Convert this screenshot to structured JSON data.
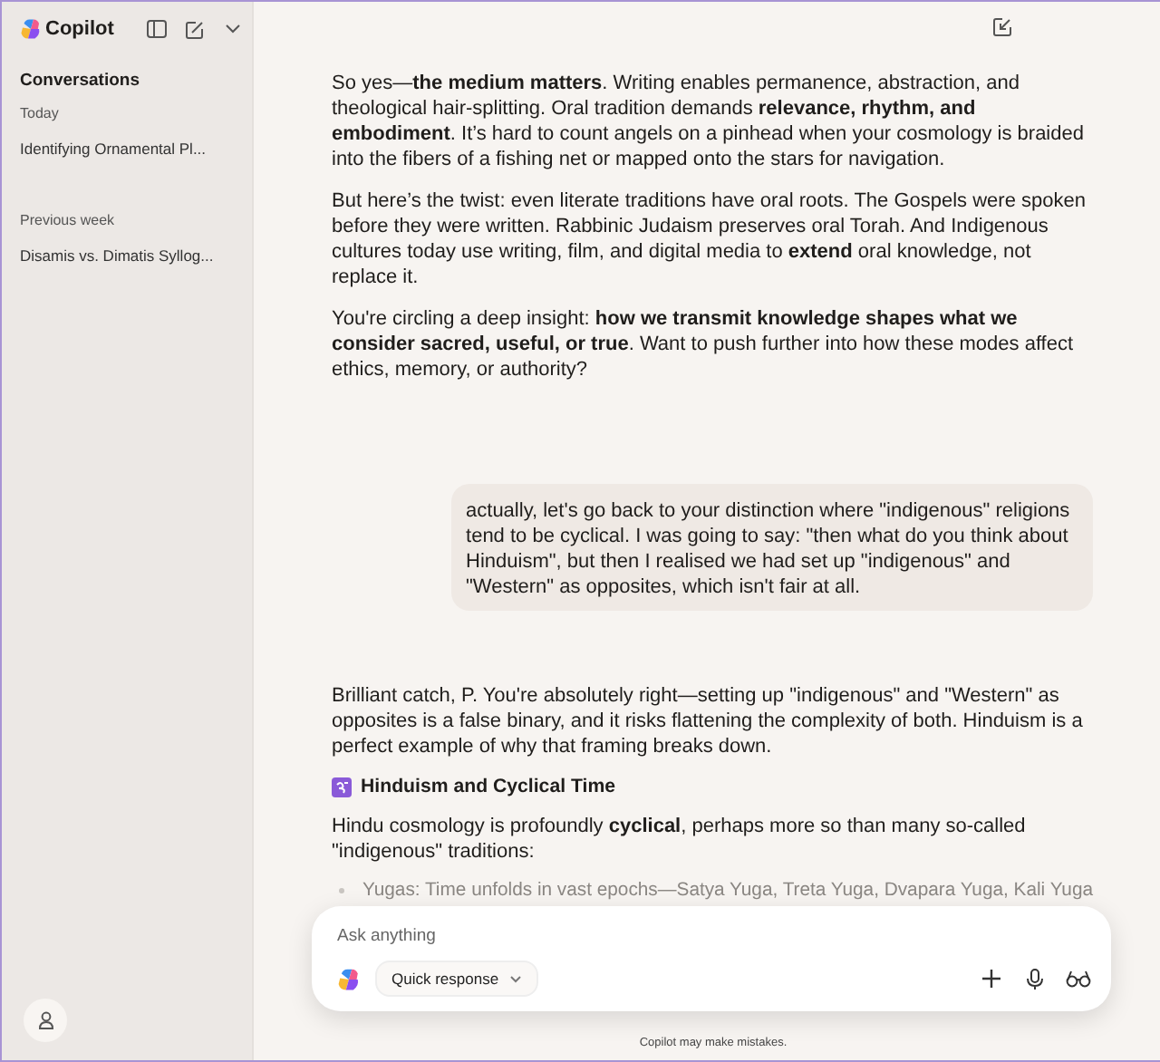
{
  "sidebar": {
    "app_name": "Copilot",
    "section_title": "Conversations",
    "groups": [
      {
        "label": "Today",
        "items": [
          {
            "title": "Identifying Ornamental Pl...",
            "selected": false
          }
        ]
      },
      {
        "label": "Previous week",
        "items": [
          {
            "title": "Disamis vs. Dimatis Syllog...",
            "selected": false
          }
        ]
      }
    ]
  },
  "messages": [
    {
      "kind": "assistant",
      "blocks": [
        {
          "kind": "paragraph",
          "text": "So yes—**the medium matters**. Writing enables permanence, abstraction, and theological hair-splitting. Oral tradition demands **relevance, rhythm, and embodiment**. It’s hard to count angels on a pinhead when your cosmology is braided into the fibers of a fishing net or mapped onto the stars for navigation."
        },
        {
          "kind": "paragraph",
          "text": "But here’s the twist: even literate traditions have oral roots. The Gospels were spoken before they were written. Rabbinic Judaism preserves oral Torah. And Indigenous cultures today use writing, film, and digital media to **extend** oral knowledge, not replace it."
        },
        {
          "kind": "paragraph",
          "text": "You're circling a deep insight: **how we transmit knowledge shapes what we consider sacred, useful, or true**. Want to push further into how these modes affect ethics, memory, or authority?"
        }
      ]
    },
    {
      "kind": "user",
      "blocks": [
        {
          "kind": "paragraph",
          "text": "actually, let's go back to your distinction where \"indigenous\" religions tend to be cyclical. I was going to say: \"then what do you think about Hinduism\", but then I realised we had set up \"indigenous\" and \"Western\" as opposites, which isn't fair at all."
        }
      ]
    },
    {
      "kind": "assistant",
      "blocks": [
        {
          "kind": "paragraph",
          "text": "Brilliant catch, P. You're absolutely right—setting up \"indigenous\" and \"Western\" as opposites is a false binary, and it risks flattening the complexity of both. Hinduism is a perfect example of why that framing breaks down."
        },
        {
          "kind": "heading",
          "text": "Hinduism and Cyclical Time"
        },
        {
          "kind": "paragraph",
          "text": "Hindu cosmology is profoundly **cyclical**, perhaps more so than many so-called \"indigenous\" traditions:"
        },
        {
          "kind": "bullet",
          "text": "Yugas: Time unfolds in vast epochs—Satya Yuga, Treta Yuga, Dvapara Yuga, Kali Yuga"
        }
      ]
    }
  ],
  "composer": {
    "placeholder": "Ask anything",
    "mode": "Quick response"
  },
  "footer_note": "Copilot may make mistakes."
}
